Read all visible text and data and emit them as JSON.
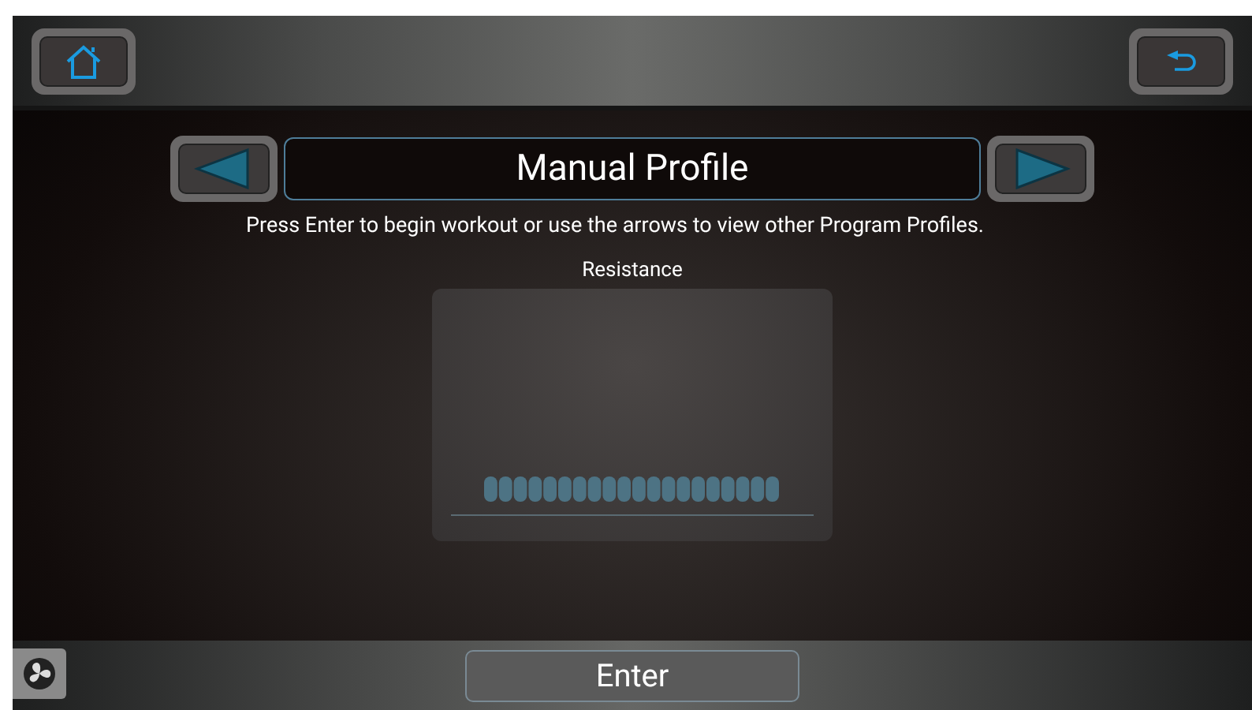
{
  "header": {
    "title": "Manual Profile"
  },
  "instructions": "Press Enter to begin workout or use the arrows to view other Program Profiles.",
  "profile": {
    "label": "Resistance"
  },
  "footer": {
    "button": "Enter"
  }
}
